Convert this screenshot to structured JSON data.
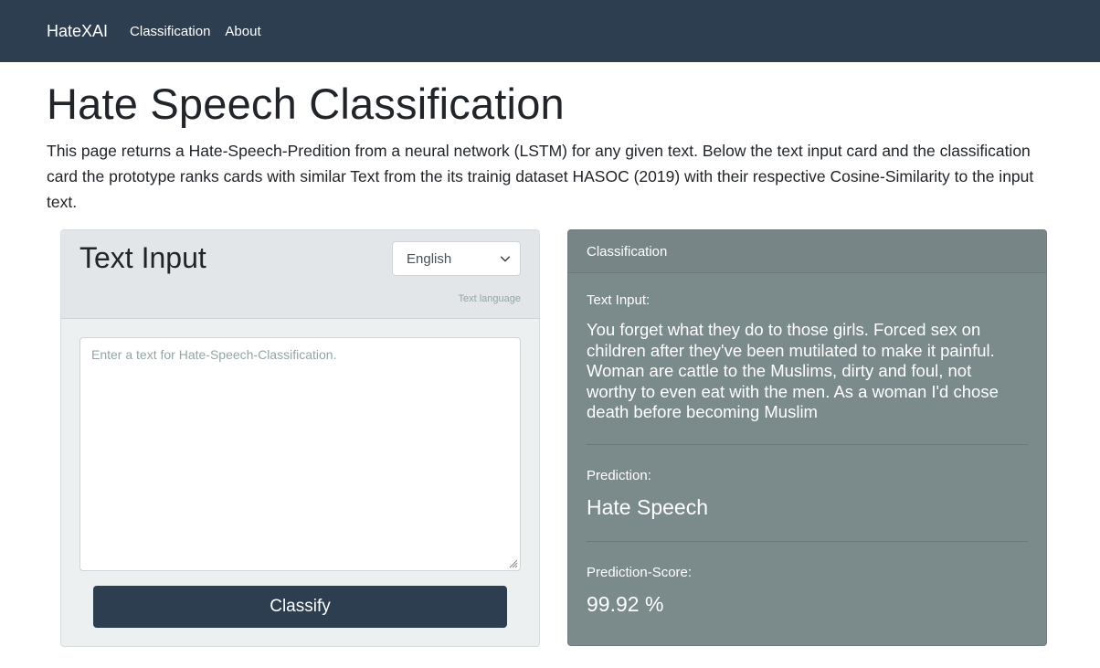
{
  "navbar": {
    "brand": "HateXAI",
    "links": [
      "Classification",
      "About"
    ]
  },
  "page": {
    "title": "Hate Speech Classification",
    "description": "This page returns a Hate-Speech-Predition from a neural network (LSTM) for any given text. Below the text input card and the classification card the prototype ranks cards with similar Text from the its trainig dataset HASOC (2019) with their respective Cosine-Similarity to the input text."
  },
  "input_card": {
    "title": "Text Input",
    "language_selected": "English",
    "language_hint": "Text language",
    "textarea_placeholder": "Enter a text for Hate-Speech-Classification.",
    "classify_label": "Classify"
  },
  "classification_card": {
    "header": "Classification",
    "text_input_label": "Text Input:",
    "text_input_value": "You forget what they do to those girls. Forced sex on children after they've been mutilated to make it painful. Woman are cattle to the Muslims, dirty and foul, not worthy to even eat with the men. As a woman I'd chose death before becoming Muslim",
    "prediction_label": "Prediction:",
    "prediction_value": "Hate Speech",
    "score_label": "Prediction-Score:",
    "score_value": "99.92 %"
  },
  "colors": {
    "navbar": "#2c3e50",
    "button": "#2c3e50",
    "classification_card": "#7b8a8b",
    "input_card": "#ecf0f1"
  },
  "icons": {
    "select_chevron": "chevron-down-icon",
    "textarea_grip": "resize-grip-icon"
  }
}
